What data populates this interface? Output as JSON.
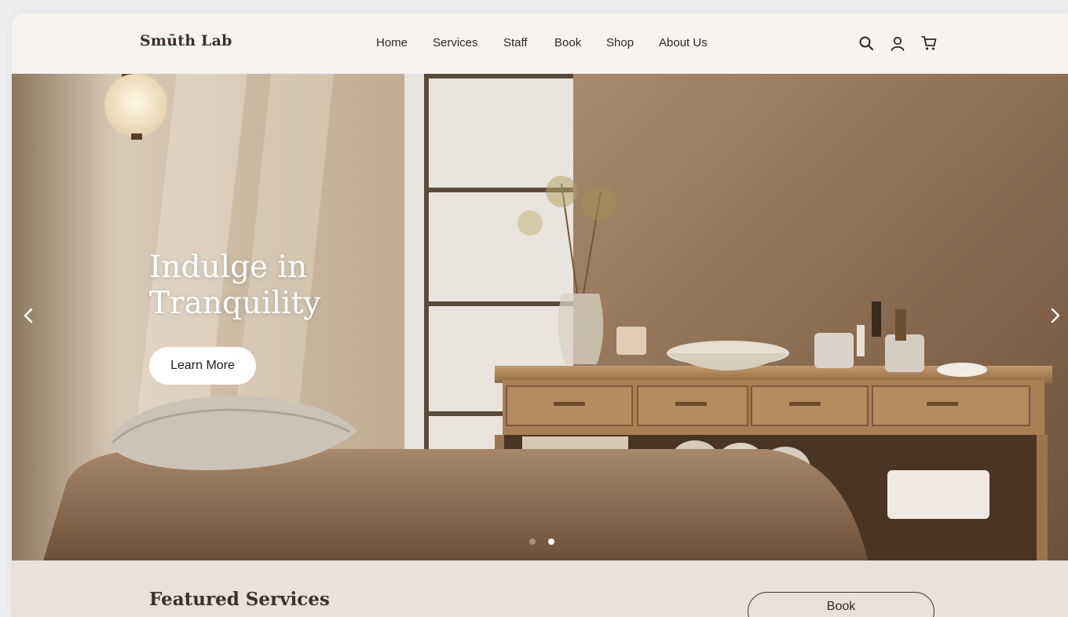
{
  "brand": {
    "name": "Smūth Lab"
  },
  "nav": {
    "items": [
      "Home",
      "Services",
      "Staff",
      "Book",
      "Shop",
      "About Us"
    ]
  },
  "header_icons": [
    "search-icon",
    "user-icon",
    "cart-icon"
  ],
  "hero": {
    "title": "Indulge in Tranquility",
    "cta_label": "Learn More",
    "slides_total": 2,
    "active_slide": 2
  },
  "featured": {
    "title": "Featured Services",
    "book_label": "Book"
  },
  "colors": {
    "header_bg": "#f7f3ef",
    "featured_bg": "#ebe0da",
    "text_dark": "#2e2825",
    "accent_white": "#ffffff"
  }
}
